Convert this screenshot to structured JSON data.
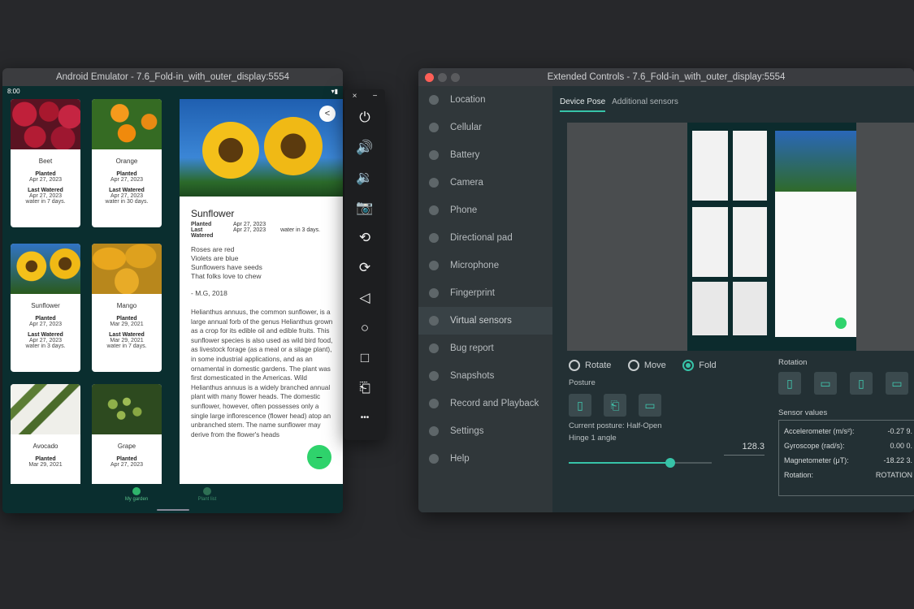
{
  "emulator": {
    "title": "Android Emulator - 7.6_Fold-in_with_outer_display:5554",
    "status_time": "8:00",
    "plants": [
      {
        "name": "Beet",
        "planted_label": "Planted",
        "planted": "Apr 27, 2023",
        "watered_label": "Last Watered",
        "watered": "Apr 27, 2023",
        "note": "water in 7 days."
      },
      {
        "name": "Orange",
        "planted_label": "Planted",
        "planted": "Apr 27, 2023",
        "watered_label": "Last Watered",
        "watered": "Apr 27, 2023",
        "note": "water in 30 days."
      },
      {
        "name": "Sunflower",
        "planted_label": "Planted",
        "planted": "Apr 27, 2023",
        "watered_label": "Last Watered",
        "watered": "Apr 27, 2023",
        "note": "water in 3 days."
      },
      {
        "name": "Mango",
        "planted_label": "Planted",
        "planted": "Mar 29, 2021",
        "watered_label": "Last Watered",
        "watered": "Mar 29, 2021",
        "note": "water in 7 days."
      },
      {
        "name": "Avocado",
        "planted_label": "Planted",
        "planted": "Mar 29, 2021",
        "watered_label": "",
        "watered": "",
        "note": ""
      },
      {
        "name": "Grape",
        "planted_label": "Planted",
        "planted": "Apr 27, 2023",
        "watered_label": "",
        "watered": "",
        "note": ""
      }
    ],
    "detail": {
      "title": "Sunflower",
      "planted_label": "Planted",
      "planted": "Apr 27, 2023",
      "watered_label": "Last Watered",
      "watered": "Apr 27, 2023",
      "watered_note": "water in 3 days.",
      "poem": [
        "Roses are red",
        "Violets are blue",
        "Sunflowers have seeds",
        "That folks love to chew"
      ],
      "attribution": "- M.G, 2018",
      "description": "Helianthus annuus, the common sunflower, is a large annual forb of the genus Helianthus grown as a crop for its edible oil and edible fruits. This sunflower species is also used as wild bird food, as livestock forage (as a meal or a silage plant), in some industrial applications, and as an ornamental in domestic gardens. The plant was first domesticated in the Americas. Wild Helianthus annuus is a widely branched annual plant with many flower heads. The domestic sunflower, however, often possesses only a single large inflorescence (flower head) atop an unbranched stem. The name sunflower may derive from the flower's heads"
    },
    "fab_symbol": "−",
    "nav": {
      "my_garden": "My garden",
      "plant_list": "Plant list"
    }
  },
  "toolbar": {
    "close": "×",
    "minimize": "−",
    "buttons": [
      {
        "name": "power-icon",
        "glyph": "⏻"
      },
      {
        "name": "volume-up-icon",
        "glyph": "🔊"
      },
      {
        "name": "volume-down-icon",
        "glyph": "🔉"
      },
      {
        "name": "camera-icon",
        "glyph": "📷"
      },
      {
        "name": "rotate-left-icon",
        "glyph": "⟲"
      },
      {
        "name": "rotate-right-icon",
        "glyph": "⟳"
      },
      {
        "name": "back-icon",
        "glyph": "◁"
      },
      {
        "name": "home-icon",
        "glyph": "○"
      },
      {
        "name": "overview-icon",
        "glyph": "□"
      },
      {
        "name": "fold-icon",
        "glyph": "⎗"
      },
      {
        "name": "more-icon",
        "glyph": "•••"
      }
    ]
  },
  "extended": {
    "title": "Extended Controls - 7.6_Fold-in_with_outer_display:5554",
    "sidebar": [
      "Location",
      "Cellular",
      "Battery",
      "Camera",
      "Phone",
      "Directional pad",
      "Microphone",
      "Fingerprint",
      "Virtual sensors",
      "Bug report",
      "Snapshots",
      "Record and Playback",
      "Settings",
      "Help"
    ],
    "active_item": "Virtual sensors",
    "tabs": [
      "Device Pose",
      "Additional sensors"
    ],
    "modes": [
      "Rotate",
      "Move",
      "Fold"
    ],
    "selected_mode": "Fold",
    "posture_label": "Posture",
    "current_posture": "Current posture: Half-Open",
    "hinge_label": "Hinge 1 angle",
    "hinge_value": "128.3",
    "hinge_fraction": 0.71,
    "rotation_label": "Rotation",
    "sensor_values_label": "Sensor values",
    "sensor_rows": [
      {
        "label": "Accelerometer (m/s²):",
        "value": "-0.27  9."
      },
      {
        "label": "Gyroscope (rad/s):",
        "value": "0.00  0."
      },
      {
        "label": "Magnetometer (μT):",
        "value": "-18.22  3."
      },
      {
        "label": "Rotation:",
        "value": "ROTATION"
      }
    ]
  },
  "colors": {
    "accent": "#37c3a8",
    "fab": "#2fd36c",
    "app_bg": "#0a2e2f"
  }
}
